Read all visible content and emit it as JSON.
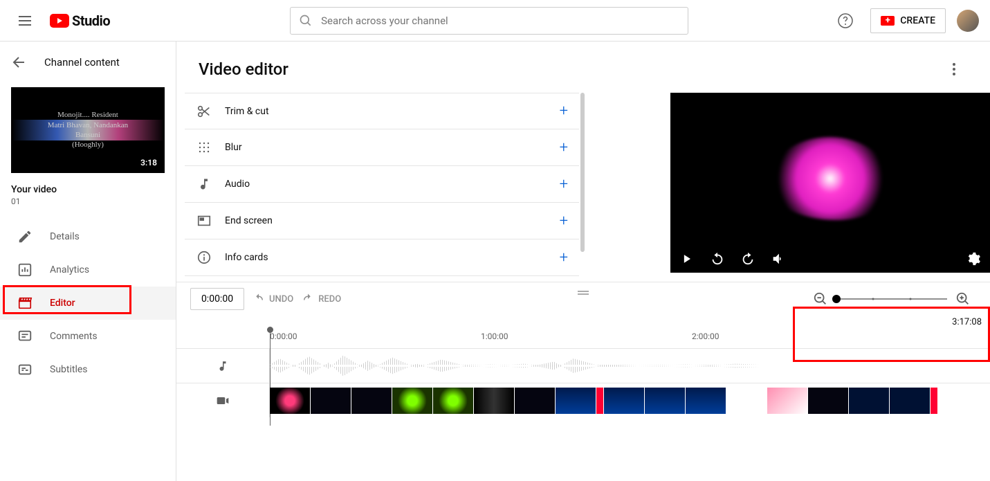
{
  "header": {
    "logo_text": "Studio",
    "search_placeholder": "Search across your channel",
    "create_label": "CREATE"
  },
  "sidebar": {
    "back_label": "Channel content",
    "thumb_duration": "3:18",
    "thumb_lines": [
      "Monojit.... Resident",
      "Matri Bhavan, Nandankan",
      "Bansuni",
      "(Hooghly)"
    ],
    "your_video_label": "Your video",
    "video_name": "01",
    "nav": [
      {
        "label": "Details"
      },
      {
        "label": "Analytics"
      },
      {
        "label": "Editor"
      },
      {
        "label": "Comments"
      },
      {
        "label": "Subtitles"
      }
    ]
  },
  "page": {
    "title": "Video editor"
  },
  "tools": [
    {
      "label": "Trim & cut"
    },
    {
      "label": "Blur"
    },
    {
      "label": "Audio"
    },
    {
      "label": "End screen"
    },
    {
      "label": "Info cards"
    }
  ],
  "timeline": {
    "current": "0:00:00",
    "undo": "UNDO",
    "redo": "REDO",
    "total": "3:17:08",
    "ticks": [
      "0:00:00",
      "1:00:00",
      "2:00:00"
    ]
  }
}
